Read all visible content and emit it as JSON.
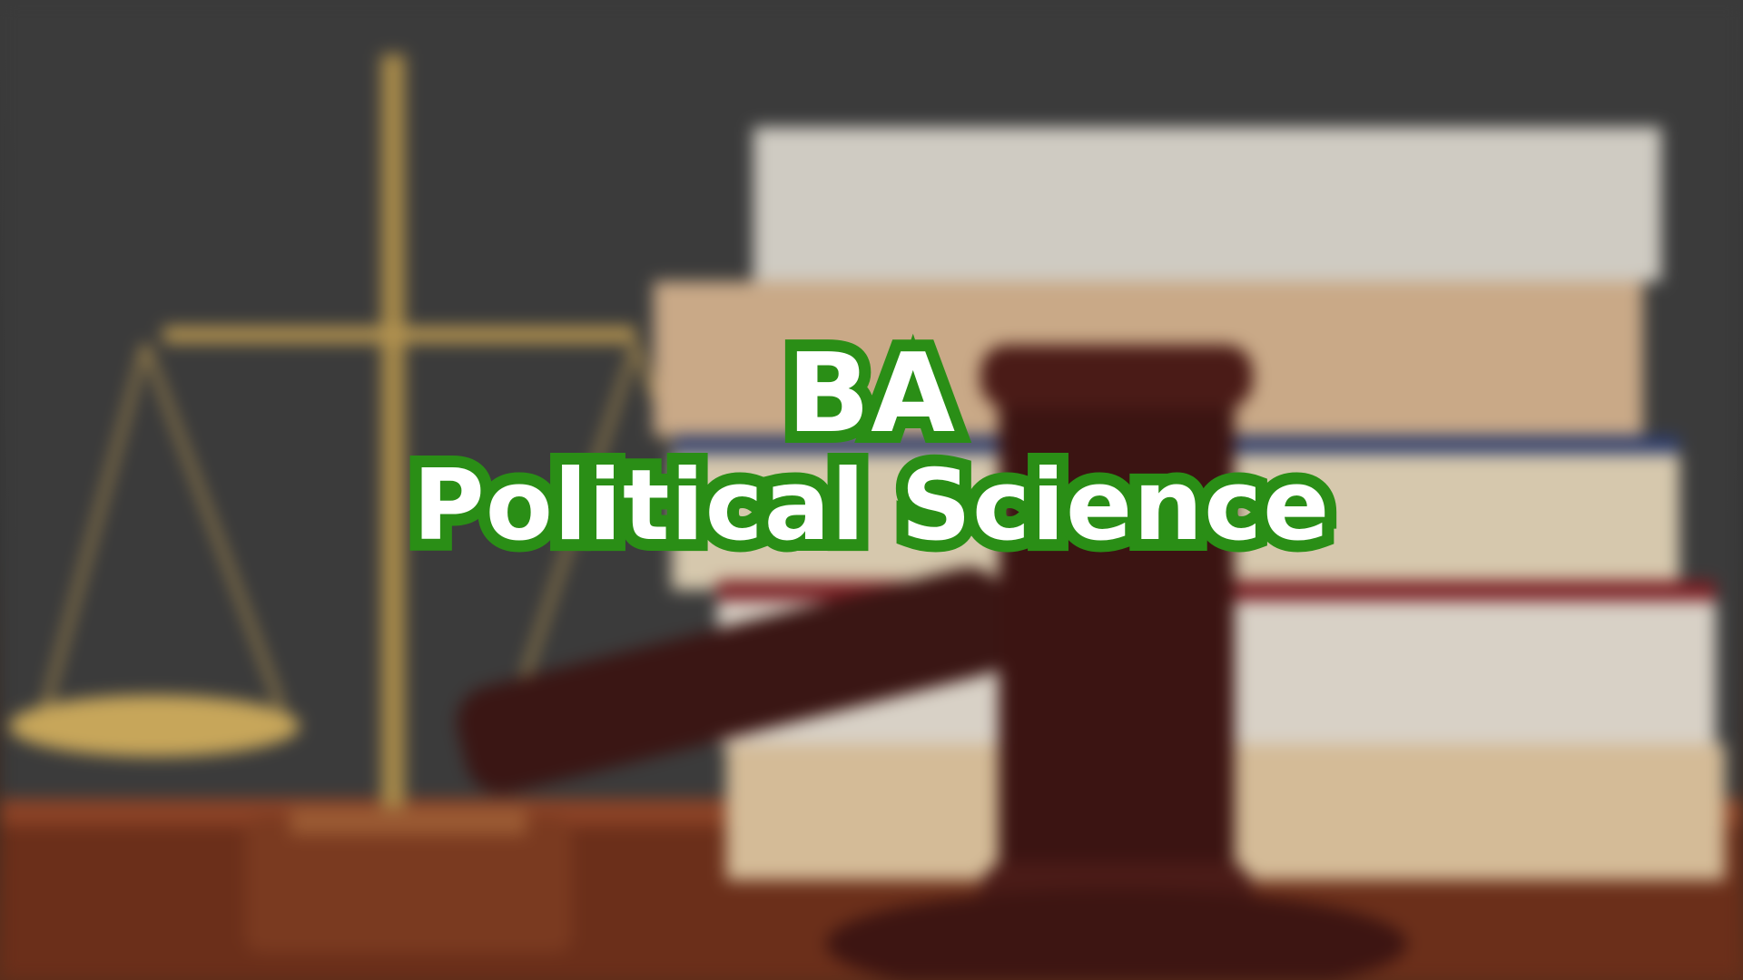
{
  "title": {
    "line1": "BA",
    "line2": "Political Science"
  },
  "colors": {
    "title_text": "#ffffff",
    "title_outline": "#2a8e16"
  },
  "background": {
    "objects": [
      "scales-of-justice",
      "stack-of-books",
      "judge-gavel",
      "wooden-desk"
    ]
  }
}
